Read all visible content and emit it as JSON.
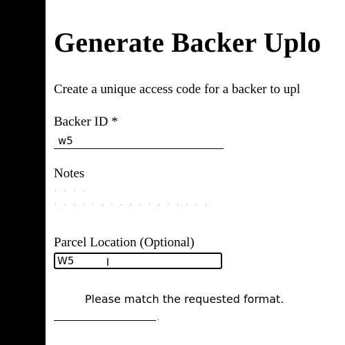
{
  "page": {
    "title": "Generate Backer Uplo",
    "subtitle": "Create a unique access code for a backer to upl"
  },
  "form": {
    "backer_id": {
      "label": "Backer ID *",
      "value": "w5"
    },
    "notes": {
      "label": "Notes",
      "placeholder_row1": "· · · ·",
      "placeholder_row2": "· · · · · · · · · · · · · · · · ·"
    },
    "parcel_location": {
      "label": "Parcel Location (Optional)",
      "value": "W5"
    },
    "validation_message": "Please match the requested format."
  },
  "icons": {
    "cursor": "text-cursor-icon"
  }
}
